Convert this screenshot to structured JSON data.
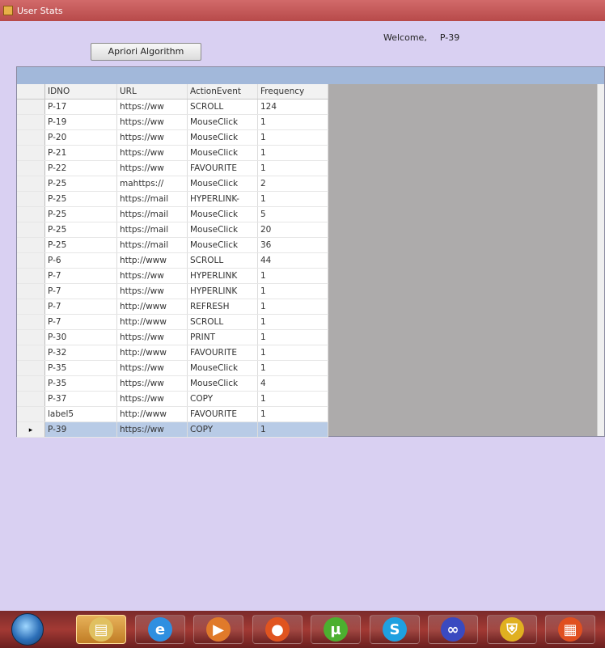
{
  "window": {
    "title": "User Stats"
  },
  "header": {
    "welcome_label": "Welcome,",
    "user_id": "P-39"
  },
  "toolbar": {
    "apriori_label": "Apriori Algorithm"
  },
  "grid": {
    "columns": [
      "IDNO",
      "URL",
      "ActionEvent",
      "Frequency"
    ],
    "rows": [
      [
        "P-17",
        "https://ww",
        "SCROLL",
        "124"
      ],
      [
        "P-19",
        "https://ww",
        "MouseClick",
        "1"
      ],
      [
        "P-20",
        "https://ww",
        "MouseClick",
        "1"
      ],
      [
        "P-21",
        "https://ww",
        "MouseClick",
        "1"
      ],
      [
        "P-22",
        "https://ww",
        "FAVOURITE",
        "1"
      ],
      [
        "P-25",
        "mahttps://",
        "MouseClick",
        "2"
      ],
      [
        "P-25",
        "https://mail",
        "HYPERLINK-",
        "1"
      ],
      [
        "P-25",
        "https://mail",
        "MouseClick",
        "5"
      ],
      [
        "P-25",
        "https://mail",
        "MouseClick",
        "20"
      ],
      [
        "P-25",
        "https://mail",
        "MouseClick",
        "36"
      ],
      [
        "P-6",
        "http://www",
        "SCROLL",
        "44"
      ],
      [
        "P-7",
        "https://ww",
        "HYPERLINK",
        "1"
      ],
      [
        "P-7",
        "https://ww",
        "HYPERLINK",
        "1"
      ],
      [
        "P-7",
        "http://www",
        "REFRESH",
        "1"
      ],
      [
        "P-7",
        "http://www",
        "SCROLL",
        "1"
      ],
      [
        "P-30",
        "https://ww",
        "PRINT",
        "1"
      ],
      [
        "P-32",
        "http://www",
        "FAVOURITE",
        "1"
      ],
      [
        "P-35",
        "https://ww",
        "MouseClick",
        "1"
      ],
      [
        "P-35",
        "https://ww",
        "MouseClick",
        "4"
      ],
      [
        "P-37",
        "https://ww",
        "COPY",
        "1"
      ],
      [
        "label5",
        "http://www",
        "FAVOURITE",
        "1"
      ],
      [
        "P-39",
        "https://ww",
        "COPY",
        "1"
      ]
    ],
    "selected_row_index": 21,
    "current_row_marker": "▸"
  },
  "taskbar": {
    "start_icon": "windows-start-orb",
    "buttons": [
      {
        "icon": "file-explorer-icon",
        "glyph": "▤",
        "active": true,
        "color": "#e0c060"
      },
      {
        "icon": "internet-explorer-icon",
        "glyph": "e",
        "active": false,
        "color": "#2f8fe0"
      },
      {
        "icon": "media-player-icon",
        "glyph": "▶",
        "active": false,
        "color": "#e07a2a"
      },
      {
        "icon": "firefox-icon",
        "glyph": "●",
        "active": false,
        "color": "#e0541f"
      },
      {
        "icon": "utorrent-icon",
        "glyph": "µ",
        "active": false,
        "color": "#4caf2f"
      },
      {
        "icon": "skype-icon",
        "glyph": "S",
        "active": false,
        "color": "#1fa0e0"
      },
      {
        "icon": "infinity-app-icon",
        "glyph": "∞",
        "active": false,
        "color": "#3a4ac0"
      },
      {
        "icon": "security-shield-icon",
        "glyph": "⛨",
        "active": false,
        "color": "#e0b020"
      },
      {
        "icon": "office-icon",
        "glyph": "▦",
        "active": false,
        "color": "#e05020"
      }
    ]
  }
}
